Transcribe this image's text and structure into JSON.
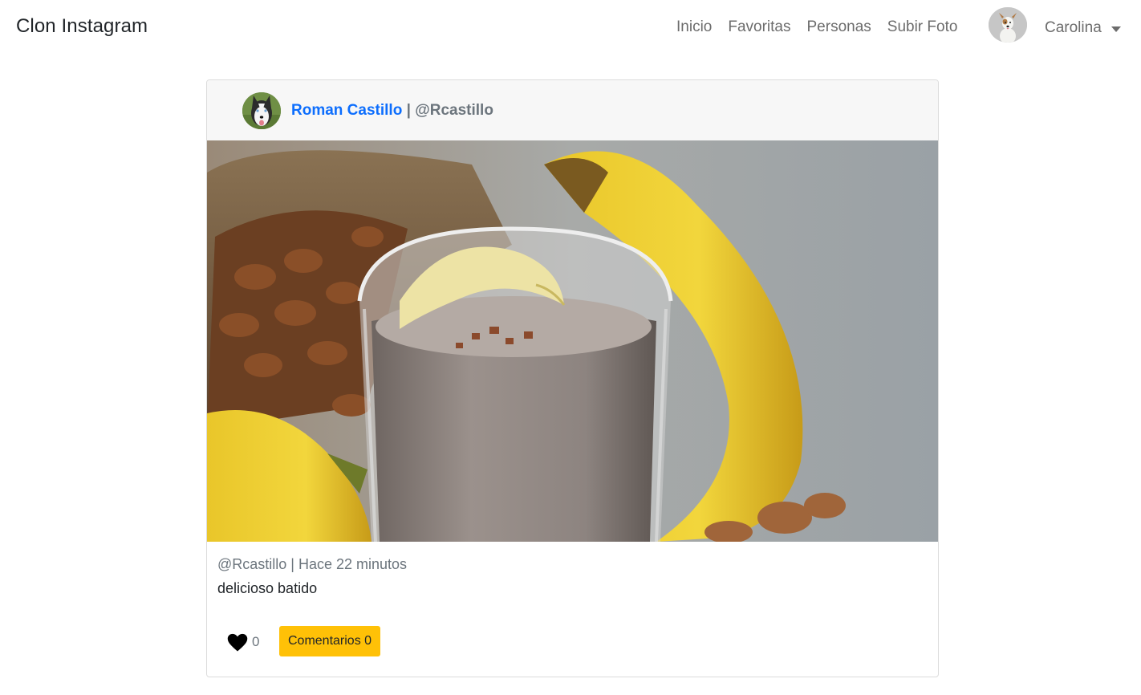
{
  "navbar": {
    "brand": "Clon Instagram",
    "links": [
      "Inicio",
      "Favoritas",
      "Personas",
      "Subir Foto"
    ],
    "user_name": "Carolina"
  },
  "post": {
    "author_name": "Roman Castillo",
    "separator": "|",
    "author_handle": "@Rcastillo",
    "meta": "@Rcastillo | Hace 22 minutos",
    "caption": "delicioso batido",
    "likes": "0",
    "comments_label": "Comentarios 0"
  },
  "colors": {
    "link_blue": "#0d6efd",
    "button_yellow": "#ffc107",
    "muted": "#6c757d"
  },
  "icons": [
    "user-avatar-icon",
    "heart-icon",
    "caret-down-icon"
  ]
}
